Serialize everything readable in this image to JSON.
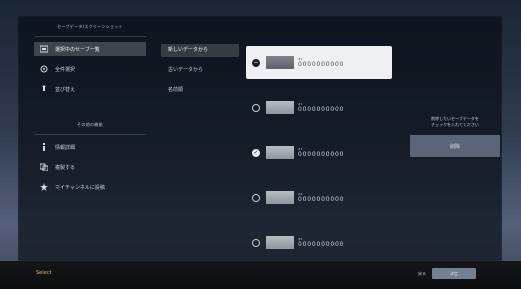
{
  "left_menu": {
    "section_1_title": "セーブデータ/スクリーンショット",
    "section_2_title": "その他の機能",
    "items_top": [
      {
        "icon": "selected-list-icon",
        "label": "選択中のセーブ一覧"
      },
      {
        "icon": "all-select-icon",
        "label": "全件選択"
      },
      {
        "icon": "sort-icon",
        "label": "並び替え"
      }
    ],
    "items_bottom": [
      {
        "icon": "info-icon",
        "label": "情報詳細"
      },
      {
        "icon": "copy-icon",
        "label": "複製する"
      },
      {
        "icon": "star-icon",
        "label": "マイチャンネルに投稿"
      }
    ]
  },
  "middle_menu": {
    "items": [
      {
        "label": "新しいデータから"
      },
      {
        "label": "古いデータから"
      },
      {
        "label": "名前順"
      }
    ]
  },
  "slots": [
    {
      "label": "#1",
      "name": "0000000000",
      "state": "focused"
    },
    {
      "label": "#2",
      "name": "0000000000",
      "state": "empty"
    },
    {
      "label": "#3",
      "name": "0000000000",
      "state": "checked"
    },
    {
      "label": "#4",
      "name": "0000000000",
      "state": "empty"
    },
    {
      "label": "#5",
      "name": "0000000000",
      "state": "empty"
    }
  ],
  "right_panel": {
    "help_text_line_1": "削除したいセーブデータを",
    "help_text_line_2": "チェックを入れてください",
    "delete_label": "削除"
  },
  "footer": {
    "left_label": "Select",
    "right_back_label": "戻る",
    "right_confirm_label": "決定"
  },
  "colors": {
    "accent": "#e0b55a",
    "panel": "#141b25",
    "highlight": "#eef0f2"
  }
}
